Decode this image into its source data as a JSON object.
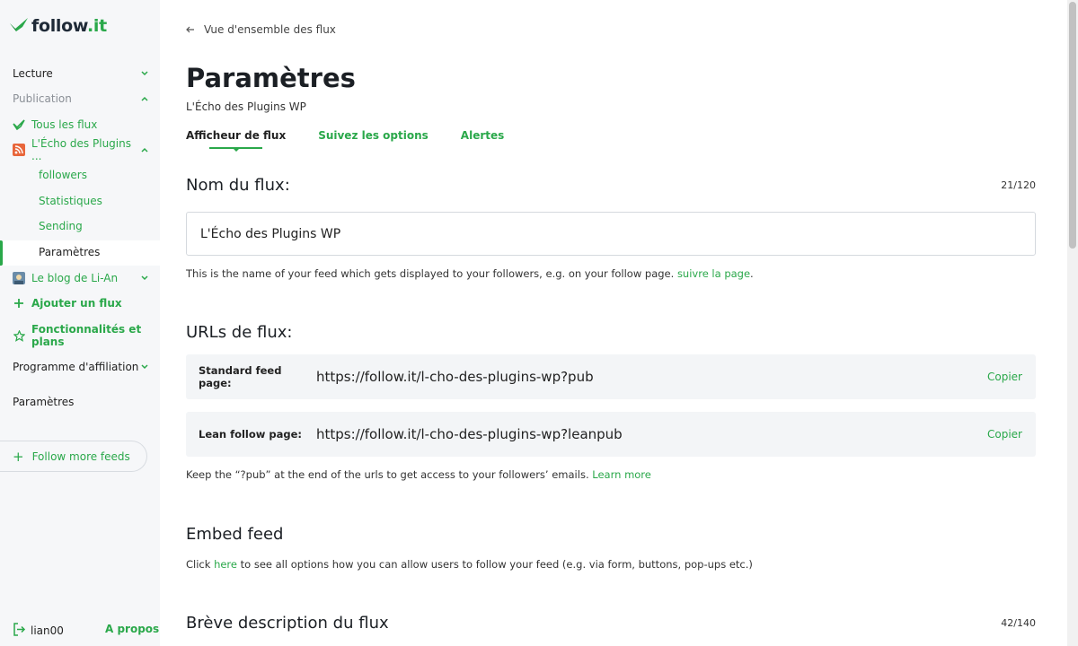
{
  "brand": {
    "name_main": "follow",
    "name_accent": ".it",
    "accent_color": "#2aa84a"
  },
  "sidebar": {
    "lecture": "Lecture",
    "publication": "Publication",
    "all_feeds": "Tous les flux",
    "feed_name": "L'Écho des Plugins ...",
    "sub_items": [
      "followers",
      "Statistiques",
      "Sending",
      "Paramètres"
    ],
    "blog": "Le blog de Li-An",
    "add_feed": "Ajouter un flux",
    "features_line1": "Fonctionnalités et",
    "features_line2": "plans",
    "affiliate": "Programme d'affiliation",
    "settings": "Paramètres",
    "follow_more": "Follow more feeds",
    "username": "lian00",
    "about": "A propos"
  },
  "header": {
    "back": "Vue d'ensemble des flux",
    "title": "Paramètres",
    "subtitle": "L'Écho des Plugins WP"
  },
  "tabs": [
    "Afficheur de flux",
    "Suivez les options",
    "Alertes"
  ],
  "feed_name_section": {
    "title": "Nom du flux:",
    "counter": "21/120",
    "value": "L'Écho des Plugins WP",
    "help": "This is the name of your feed which gets displayed to your followers, e.g. on your follow page.",
    "help_link": "suivre la page",
    "help_end": "."
  },
  "urls_section": {
    "title": "URLs de flux:",
    "rows": [
      {
        "label": "Standard feed page:",
        "value": "https://follow.it/l-cho-des-plugins-wp?pub",
        "copy": "Copier"
      },
      {
        "label": "Lean follow page:",
        "value": "https://follow.it/l-cho-des-plugins-wp?leanpub",
        "copy": "Copier"
      }
    ],
    "help": "Keep the “?pub” at the end of the urls to get access to your followers’ emails.",
    "help_link": "Learn more"
  },
  "embed_section": {
    "title": "Embed feed",
    "help_pre": "Click",
    "help_link": "here",
    "help_post": "to see all options how you can allow users to follow your feed (e.g. via form, buttons, pop-ups etc.)"
  },
  "description_section": {
    "title": "Brève description du flux",
    "counter": "42/140"
  }
}
